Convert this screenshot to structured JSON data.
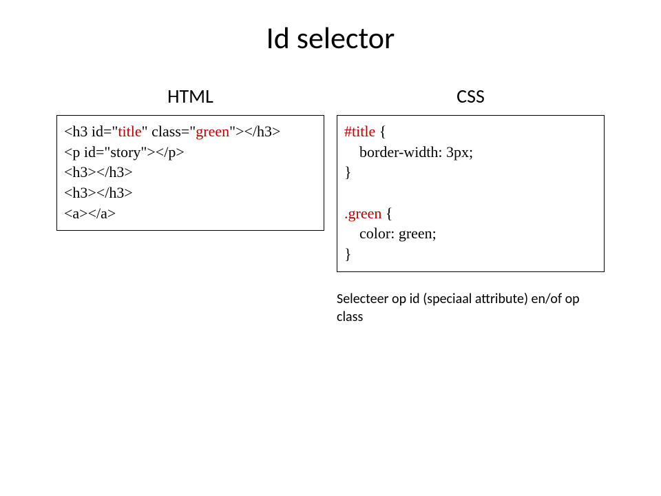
{
  "title": "Id selector",
  "left": {
    "header": "HTML",
    "code_parts": {
      "p1": "<h3 id=\"",
      "hl1": "title",
      "p2": "\" class=\"",
      "hl2": "green",
      "p3": "\"></h3>\n<p id=\"story\"></p>\n<h3></h3>\n<h3></h3>\n<a></a>"
    }
  },
  "right": {
    "header": "CSS",
    "code_parts": {
      "hl1": "#title",
      "p1": " {\n    border-width: 3px;\n}\n\n",
      "hl2": ".green",
      "p2": " {\n    color: green;\n}"
    },
    "caption": "Selecteer op id (speciaal attribute) en/of op class"
  }
}
